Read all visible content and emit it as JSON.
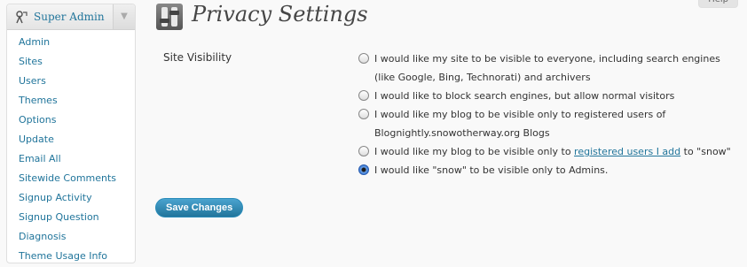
{
  "sidebar": {
    "title": "Super Admin",
    "items": [
      "Admin",
      "Sites",
      "Users",
      "Themes",
      "Options",
      "Update",
      "Email All",
      "Sitewide Comments",
      "Signup Activity",
      "Signup Question",
      "Diagnosis",
      "Theme Usage Info"
    ]
  },
  "help_tab": "Help",
  "page_title": "Privacy Settings",
  "site_visibility": {
    "label": "Site Visibility",
    "option1": "I would like my site to be visible to everyone, including search engines (like Google, Bing, Technorati) and archivers",
    "option2": "I would like to block search engines, but allow normal visitors",
    "option3": "I would like my blog to be visible only to registered users of Blognightly.snowotherway.org Blogs",
    "option4_pre": "I would like my blog to be visible only to ",
    "option4_link": "registered users I add",
    "option4_post": " to \"snow\"",
    "option5": "I would like \"snow\" to be visible only to Admins.",
    "selected_index": 5
  },
  "save_label": "Save Changes"
}
